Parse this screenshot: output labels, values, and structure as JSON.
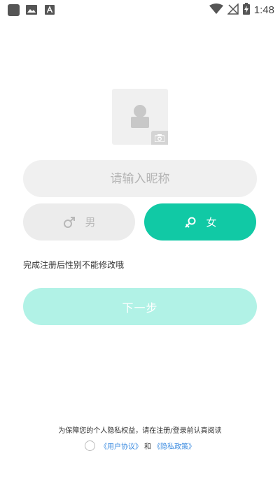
{
  "status_bar": {
    "time": "1:48",
    "left_icons": [
      "app-square-icon",
      "image-icon",
      "font-a-icon"
    ],
    "right_icons": [
      "wifi-icon",
      "no-signal-icon",
      "battery-charging-icon"
    ]
  },
  "avatar": {
    "placeholder_icon": "person-placeholder-icon",
    "badge_icon": "camera-icon"
  },
  "nickname": {
    "placeholder": "请输入昵称",
    "value": ""
  },
  "gender": {
    "male_label": "男",
    "female_label": "女",
    "selected": "female"
  },
  "hint": "完成注册后性别不能修改哦",
  "next_button": "下一步",
  "privacy": {
    "notice": "为保障您的个人隐私权益，请在注册/登录前认真阅读",
    "user_agreement": "《用户协议》",
    "conjunction": "和",
    "privacy_policy": "《隐私政策》"
  },
  "colors": {
    "accent": "#11c9a5",
    "next_button_disabled": "#b1f2e6",
    "link": "#3b8be0",
    "field_bg": "#f0f0f0"
  }
}
